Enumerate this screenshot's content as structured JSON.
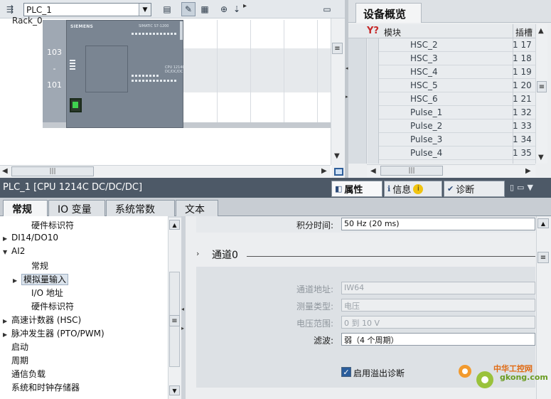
{
  "device_view": {
    "device_select": "PLC_1",
    "rack_label": "Rack_0",
    "slot_numbers": [
      "103",
      "-",
      "101"
    ],
    "cpu": {
      "brand": "SIEMENS",
      "model": "SIMATIC S7-1200",
      "sub": "CPU 1214C\nDC/DC/DC"
    }
  },
  "overview": {
    "tab": "设备概览",
    "col_module": "模块",
    "col_slot": "插槽",
    "rows": [
      {
        "name": "HSC_2",
        "slot": "1 17"
      },
      {
        "name": "HSC_3",
        "slot": "1 18"
      },
      {
        "name": "HSC_4",
        "slot": "1 19"
      },
      {
        "name": "HSC_5",
        "slot": "1 20"
      },
      {
        "name": "HSC_6",
        "slot": "1 21"
      },
      {
        "name": "Pulse_1",
        "slot": "1 32"
      },
      {
        "name": "Pulse_2",
        "slot": "1 33"
      },
      {
        "name": "Pulse_3",
        "slot": "1 34"
      },
      {
        "name": "Pulse_4",
        "slot": "1 35"
      }
    ]
  },
  "inspector": {
    "title": "PLC_1 [CPU 1214C DC/DC/DC]",
    "tabs": {
      "properties": "属性",
      "info": "信息",
      "diagnostics": "诊断"
    },
    "subtabs": [
      "常规",
      "IO 变量",
      "系统常数",
      "文本"
    ]
  },
  "tree": {
    "items": [
      {
        "label": "硬件标识符",
        "indent": 2,
        "toggle": ""
      },
      {
        "label": "DI14/DO10",
        "indent": 0,
        "toggle": "▶"
      },
      {
        "label": "AI2",
        "indent": 0,
        "toggle": "▼"
      },
      {
        "label": "常规",
        "indent": 2,
        "toggle": ""
      },
      {
        "label": "模拟量输入",
        "indent": 1,
        "toggle": "▶"
      },
      {
        "label": "I/O 地址",
        "indent": 2,
        "toggle": ""
      },
      {
        "label": "硬件标识符",
        "indent": 2,
        "toggle": ""
      },
      {
        "label": "高速计数器 (HSC)",
        "indent": 0,
        "toggle": "▶"
      },
      {
        "label": "脉冲发生器 (PTO/PWM)",
        "indent": 0,
        "toggle": "▶"
      },
      {
        "label": "启动",
        "indent": 0,
        "toggle": ""
      },
      {
        "label": "周期",
        "indent": 0,
        "toggle": ""
      },
      {
        "label": "通信负载",
        "indent": 0,
        "toggle": ""
      },
      {
        "label": "系统和时钟存储器",
        "indent": 0,
        "toggle": ""
      }
    ],
    "selected_index": 4
  },
  "properties": {
    "integration_time_label": "积分时间:",
    "integration_time_value": "50 Hz (20 ms)",
    "channel_title": "通道0",
    "channel_address_label": "通道地址:",
    "channel_address_value": "IW64",
    "measure_type_label": "测量类型:",
    "measure_type_value": "电压",
    "voltage_range_label": "电压范围:",
    "voltage_range_value": "0 到 10 V",
    "filter_label": "滤波:",
    "filter_value": "弱（4 个周期）",
    "overflow_checkbox_label": "启用溢出诊断",
    "overflow_checked": true
  },
  "watermark": {
    "line1": "中华工控网",
    "line2": "gkong.com"
  },
  "colors": {
    "inspector_bar": "#4d5967",
    "accent": "#2a5d9c",
    "module_green": "#3fd24f"
  }
}
